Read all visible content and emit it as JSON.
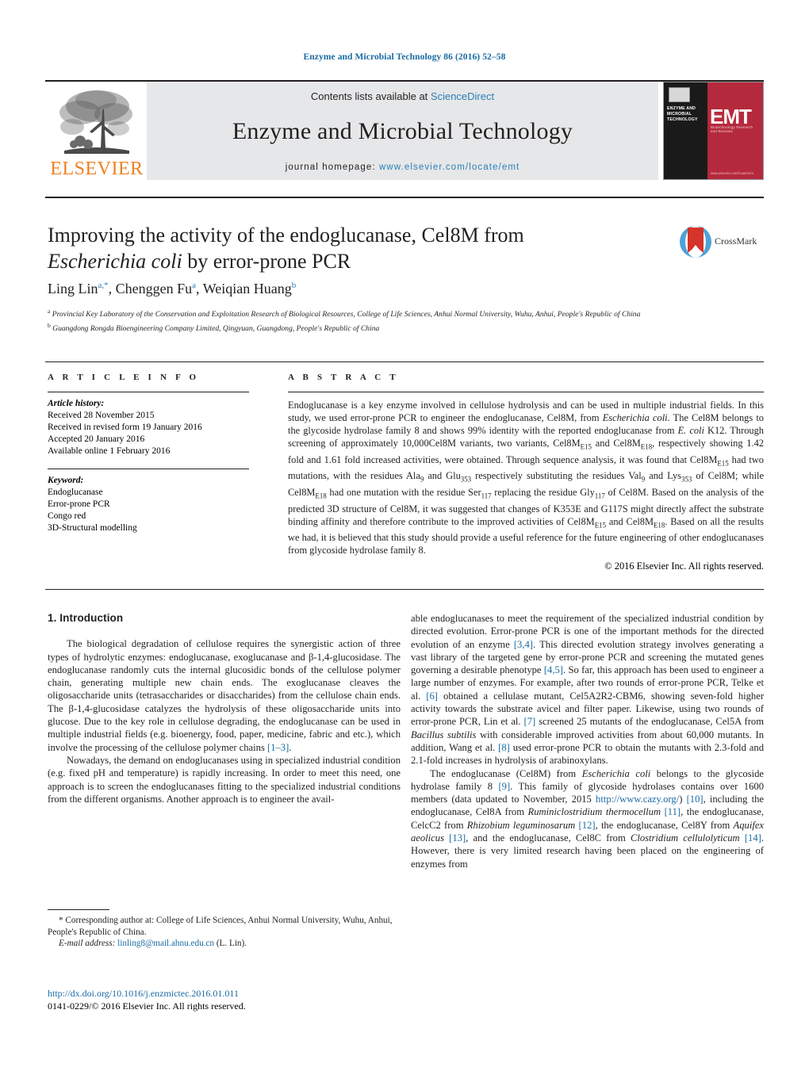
{
  "running_head": "Enzyme and Microbial Technology 86 (2016) 52–58",
  "masthead": {
    "publisher": "ELSEVIER",
    "contents_prefix": "Contents lists available at ",
    "contents_link": "ScienceDirect",
    "journal_name": "Enzyme and Microbial Technology",
    "homepage_prefix": "journal homepage: ",
    "homepage_url": "www.elsevier.com/locate/emt",
    "cover": {
      "journal_title_lines": "ENZYME AND MICROBIAL TECHNOLOGY",
      "acronym": "EMT",
      "subtitle": "Biotechnology Research and Reviews",
      "footer_url": "www.elsevier.com/locate/emt"
    }
  },
  "article": {
    "title_line1": "Improving the activity of the endoglucanase, Cel8M from",
    "title_italic": "Escherichia coli",
    "title_line2_rest": " by error-prone PCR",
    "crossmark_label": "CrossMark",
    "authors": [
      {
        "name": "Ling Lin",
        "sup": "a,*"
      },
      {
        "name": "Chenggen Fu",
        "sup": "a"
      },
      {
        "name": "Weiqian Huang",
        "sup": "b"
      }
    ],
    "affiliations": [
      {
        "mark": "a",
        "text": "Provincial Key Laboratory of the Conservation and Exploitation Research of Biological Resources, College of Life Sciences, Anhui Normal University, Wuhu, Anhui, People's Republic of China"
      },
      {
        "mark": "b",
        "text": "Guangdong Rongda Bioengineering Company Limited, Qingyuan, Guangdong, People's Republic of China"
      }
    ]
  },
  "article_info": {
    "label": "A R T I C L E   I N F O",
    "history_heading": "Article history:",
    "history": [
      "Received 28 November 2015",
      "Received in revised form 19 January 2016",
      "Accepted 20 January 2016",
      "Available online 1 February 2016"
    ],
    "keyword_heading": "Keyword:",
    "keywords": [
      "Endoglucanase",
      "Error-prone PCR",
      "Congo red",
      "3D-Structural modelling"
    ]
  },
  "abstract": {
    "label": "A B S T R A C T",
    "copyright": "© 2016 Elsevier Inc. All rights reserved."
  },
  "body": {
    "intro_heading": "1.  Introduction"
  },
  "footnotes": {
    "corresponding": "* Corresponding author at: College of Life Sciences, Anhui Normal University, Wuhu, Anhui, People's Republic of China.",
    "email_label": "E-mail address:",
    "email": "linling8@mail.ahnu.edu.cn",
    "email_suffix": " (L. Lin).",
    "doi": "http://dx.doi.org/10.1016/j.enzmictec.2016.01.011",
    "issn_line": "0141-0229/© 2016 Elsevier Inc. All rights reserved."
  },
  "colors": {
    "link": "#1a6ba3",
    "band": "#e6e7e8",
    "elsevier_orange": "#f08020",
    "cover_red": "#b5293d"
  }
}
